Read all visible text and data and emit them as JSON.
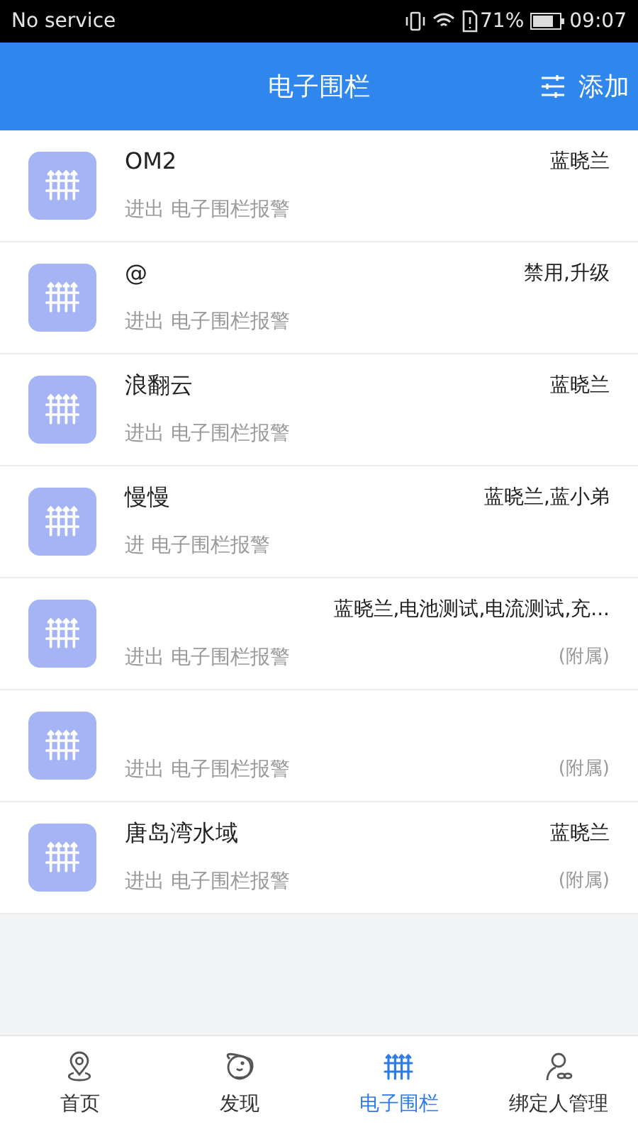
{
  "status_bar": {
    "carrier": "No service",
    "battery": "71%",
    "time": "09:07"
  },
  "header": {
    "title": "电子围栏",
    "action": "添加"
  },
  "fences": [
    {
      "name": "OM2",
      "users": "蓝晓兰",
      "alarm": "进出 电子围栏报警"
    },
    {
      "name": "@",
      "users": "禁用,升级",
      "alarm": "进出 电子围栏报警"
    },
    {
      "name": "浪翻云",
      "users": "蓝晓兰",
      "alarm": "进出 电子围栏报警"
    },
    {
      "name": "慢慢",
      "users": "蓝晓兰,蓝小弟",
      "alarm": "进 电子围栏报警"
    },
    {
      "users": "蓝晓兰,电池测试,电流测试,充...",
      "alarm": "进出 电子围栏报警",
      "tag": "(附属)"
    },
    {
      "alarm": "进出 电子围栏报警",
      "tag": "(附属)"
    },
    {
      "name": "唐岛湾水域",
      "users": "蓝晓兰",
      "alarm": "进出 电子围栏报警",
      "tag": "(附属)"
    }
  ],
  "tab_bar": [
    {
      "label": "首页",
      "kind": "home",
      "selected": false
    },
    {
      "label": "发现",
      "kind": "discover",
      "selected": false
    },
    {
      "label": "电子围栏",
      "kind": "fence",
      "selected": true
    },
    {
      "label": "绑定人管理",
      "kind": "people",
      "selected": false
    }
  ]
}
